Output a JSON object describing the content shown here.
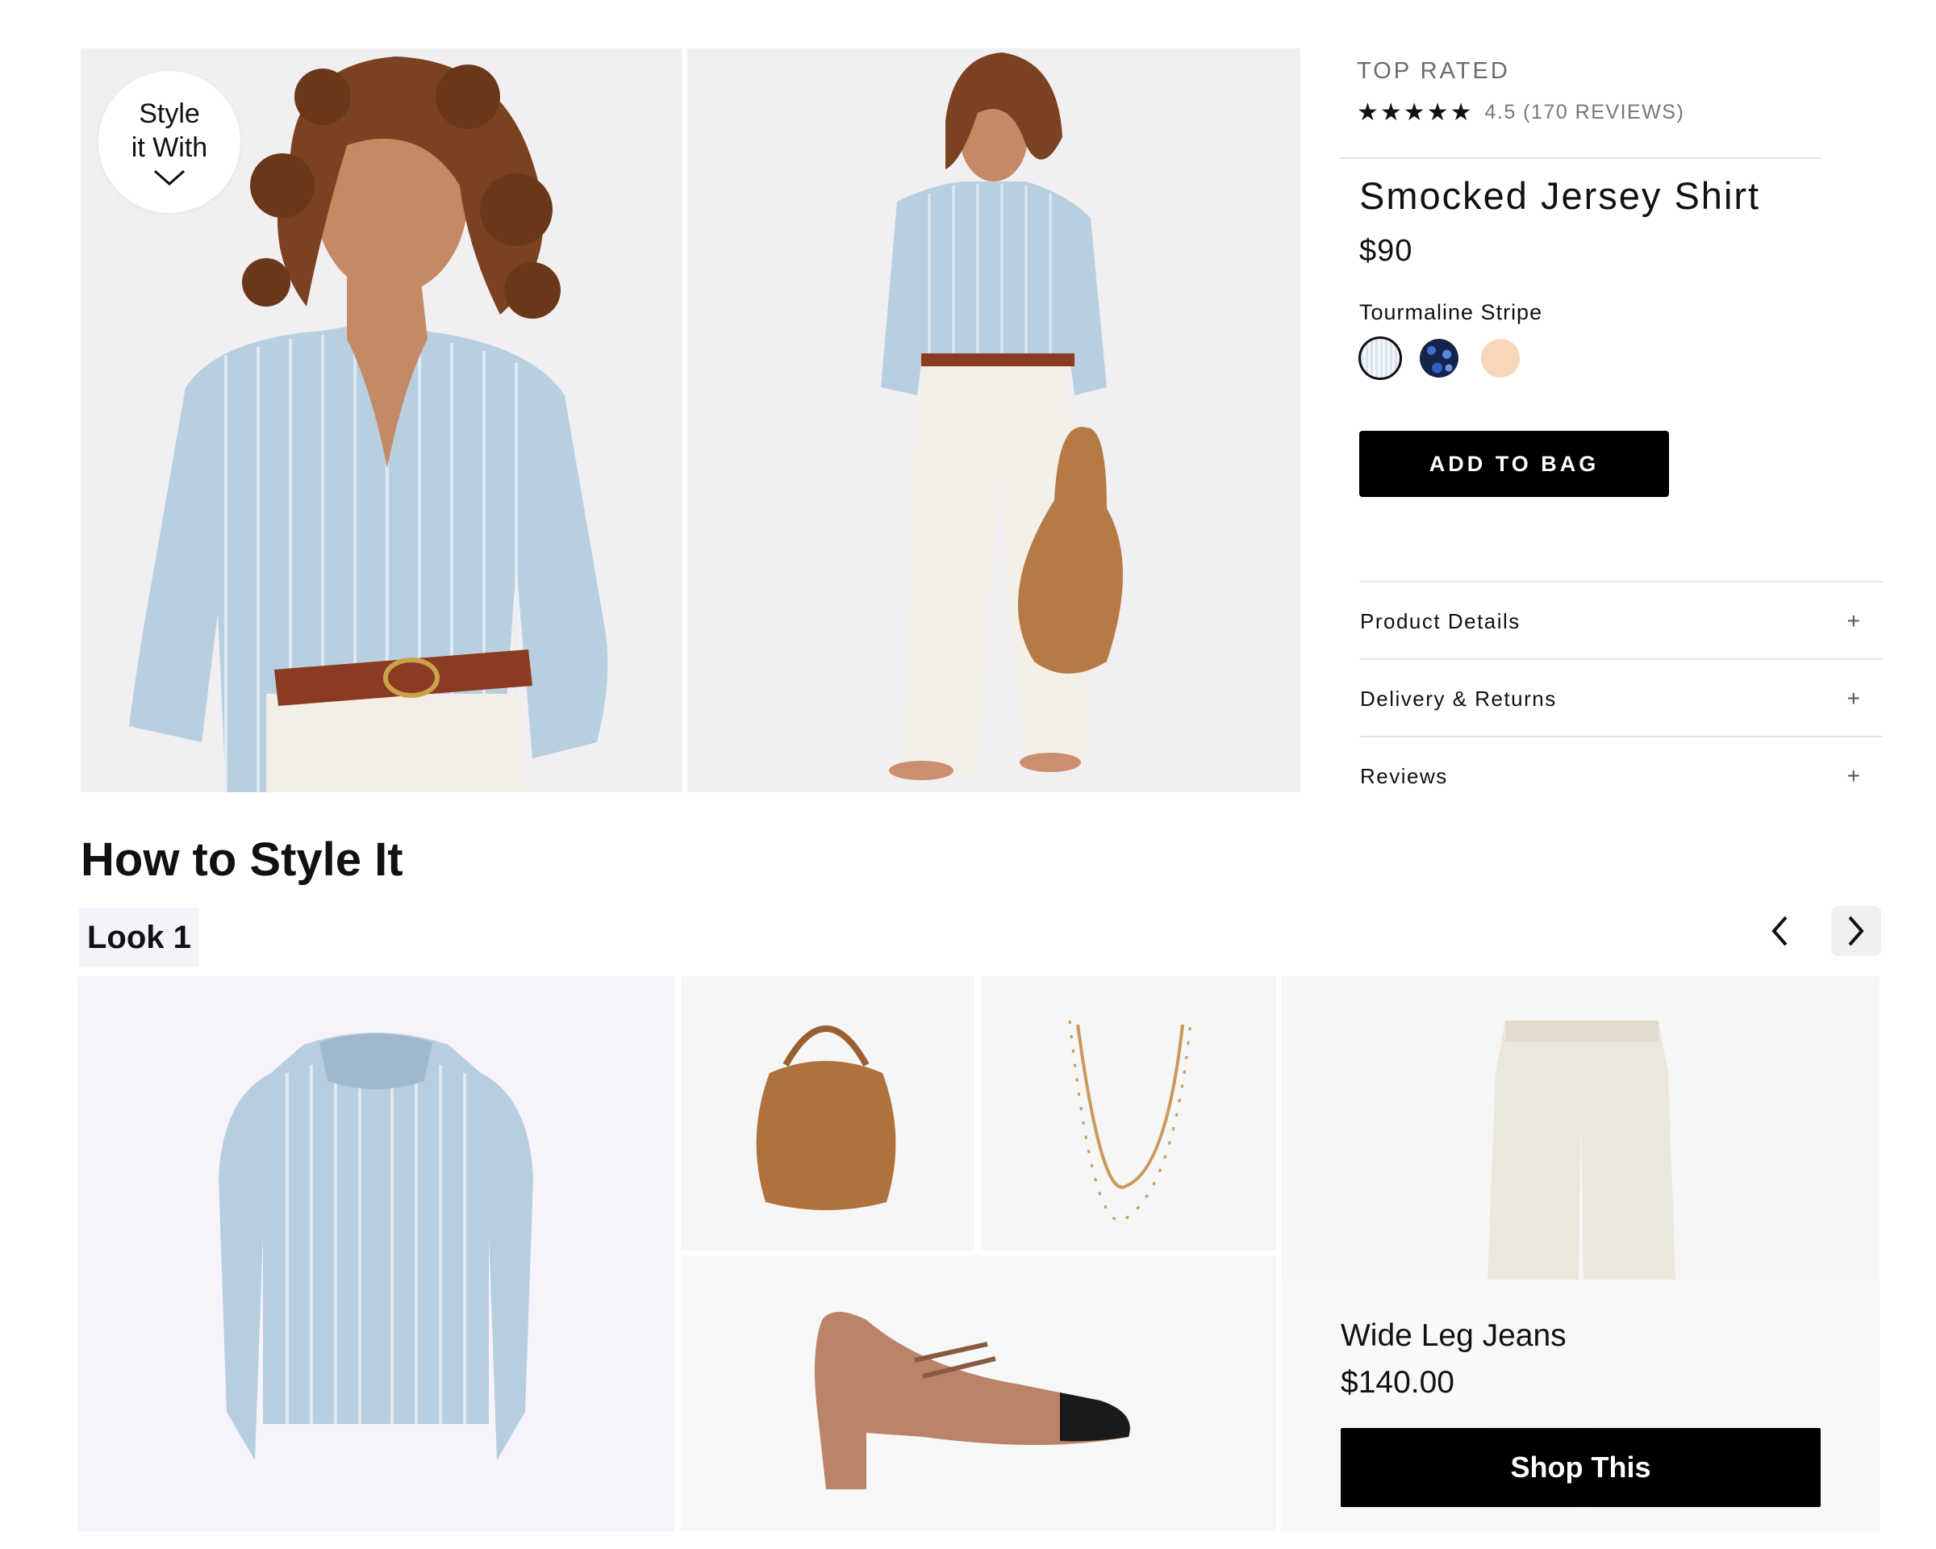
{
  "hero": {
    "badge_line1": "Style",
    "badge_line2": "it With"
  },
  "product": {
    "top_label": "TOP RATED",
    "stars": "★★★★★",
    "rating_text": "4.5 (170 REVIEWS)",
    "rating_value": 4.5,
    "title": "Smocked Jersey Shirt",
    "price": "$90",
    "color_name": "Tourmaline Stripe",
    "swatches": [
      {
        "name": "Tourmaline Stripe",
        "selected": true
      },
      {
        "name": "navy floral",
        "selected": false
      },
      {
        "name": "peach",
        "selected": false
      }
    ],
    "add_to_bag": "ADD TO BAG",
    "accordion": [
      {
        "label": "Product Details",
        "icon": "+"
      },
      {
        "label": "Delivery & Returns",
        "icon": "+"
      },
      {
        "label": "Reviews",
        "icon": "+"
      }
    ]
  },
  "style_section": {
    "title": "How to Style It",
    "look_label": "Look 1",
    "featured": {
      "name": "Wide Leg Jeans",
      "price": "$140.00",
      "cta": "Shop This"
    }
  },
  "colors": {
    "button_bg": "#000000",
    "look_tab_bg": "#f6f2fa",
    "shirt_tile_bg": "#f6f3fb"
  }
}
